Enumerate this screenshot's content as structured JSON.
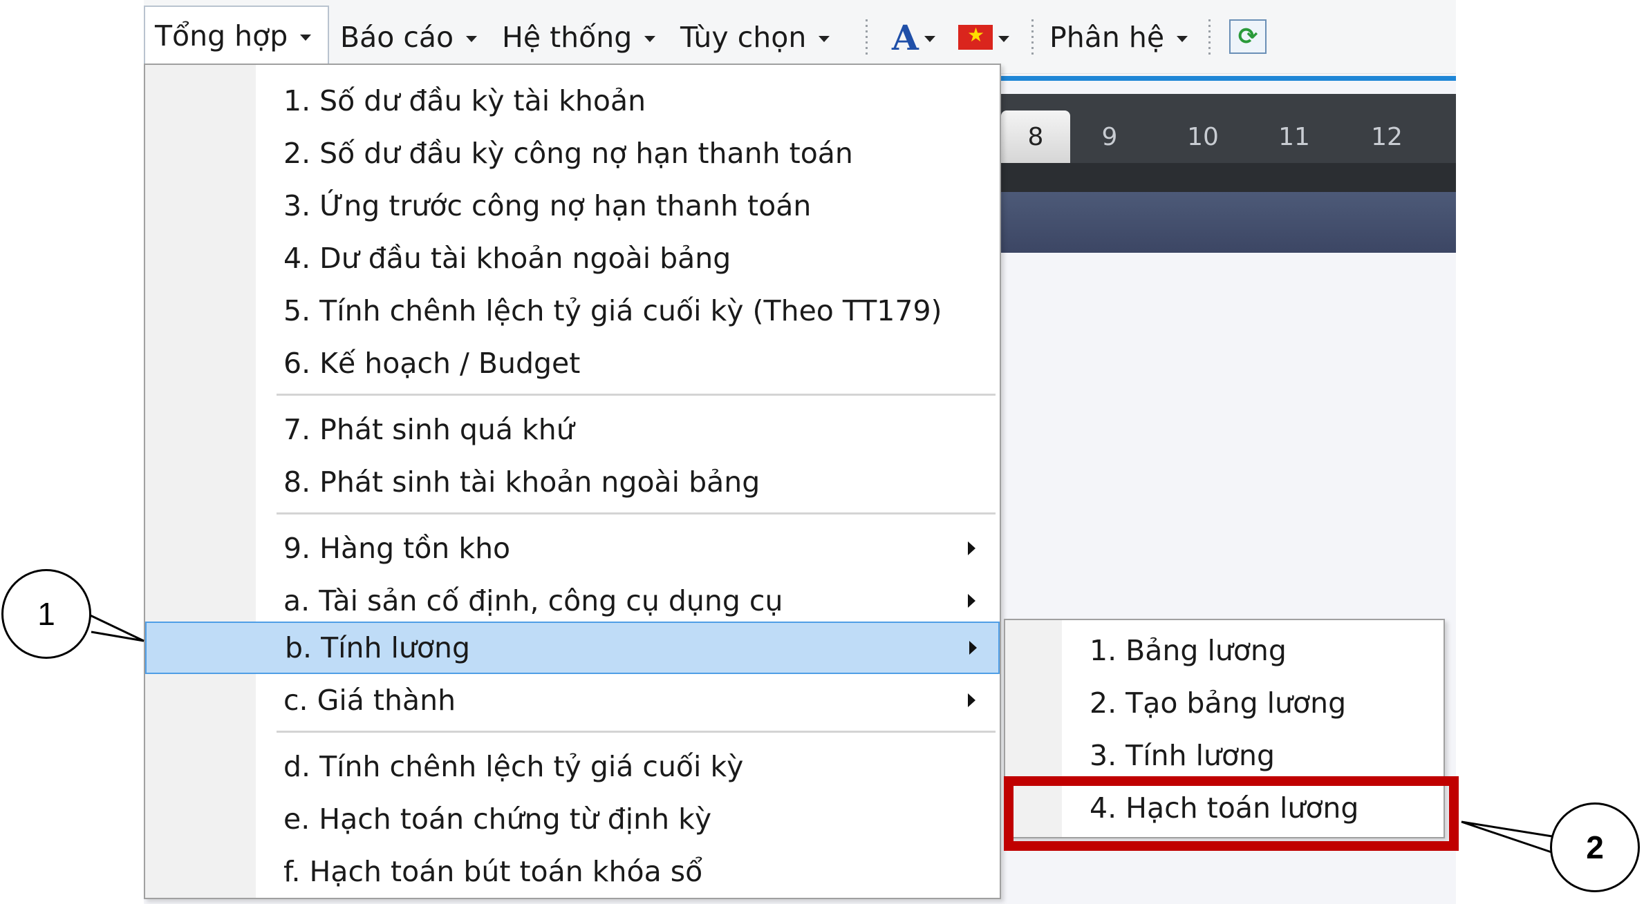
{
  "toolbar": {
    "menus": [
      {
        "label": "Tổng hợp"
      },
      {
        "label": "Báo cáo"
      },
      {
        "label": "Hệ thống"
      },
      {
        "label": "Tùy chọn"
      }
    ],
    "font_icon_label": "A",
    "module_menu": "Phân hệ"
  },
  "month_tabs": [
    "8",
    "9",
    "10",
    "11",
    "12"
  ],
  "main_menu": {
    "items": [
      {
        "label": "1. Số dư đầu kỳ tài khoản"
      },
      {
        "label": "2. Số dư đầu kỳ công nợ hạn thanh toán"
      },
      {
        "label": "3. Ứng trước công nợ hạn thanh toán"
      },
      {
        "label": "4. Dư đầu tài khoản ngoài bảng"
      },
      {
        "label": "5. Tính chênh lệch tỷ giá cuối kỳ (Theo TT179)"
      },
      {
        "label": "6. Kế hoạch / Budget"
      },
      {
        "label": "7. Phát sinh quá khứ"
      },
      {
        "label": "8. Phát sinh tài khoản ngoài bảng"
      },
      {
        "label": "9. Hàng tồn kho"
      },
      {
        "label": "a. Tài sản cố định, công cụ dụng cụ"
      },
      {
        "label": "b. Tính lương"
      },
      {
        "label": "c. Giá thành"
      },
      {
        "label": "d. Tính chênh lệch tỷ giá cuối kỳ"
      },
      {
        "label": "e. Hạch toán chứng từ định kỳ"
      },
      {
        "label": "f. Hạch toán bút toán khóa sổ"
      }
    ]
  },
  "submenu": {
    "items": [
      {
        "label": "1. Bảng lương"
      },
      {
        "label": "2. Tạo bảng lương"
      },
      {
        "label": "3. Tính lương"
      },
      {
        "label": "4. Hạch toán lương"
      }
    ]
  },
  "callouts": {
    "one": "1",
    "two": "2"
  },
  "colors": {
    "highlight": "#bfdcf7",
    "annotation_red": "#c00000"
  }
}
